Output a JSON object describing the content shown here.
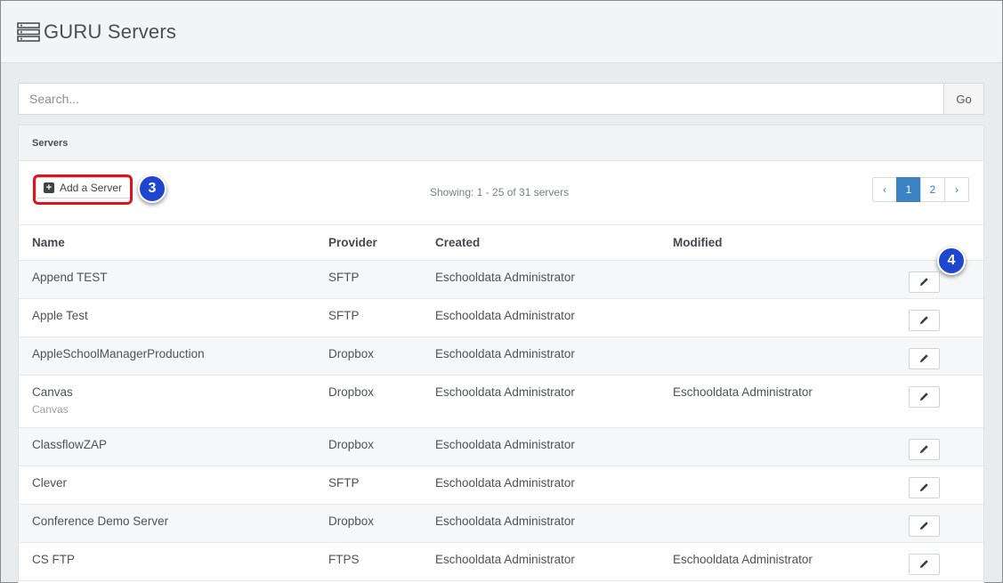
{
  "header": {
    "title": "GURU Servers",
    "icon": "server-icon"
  },
  "search": {
    "placeholder": "Search...",
    "value": "",
    "go_label": "Go"
  },
  "panel": {
    "heading": "Servers",
    "add_label": "Add a Server",
    "showing": "Showing: 1 - 25 of 31 servers"
  },
  "pagination": {
    "prev": "‹",
    "pages": [
      "1",
      "2"
    ],
    "active": "1",
    "next": "›"
  },
  "callouts": {
    "add": "3",
    "edit": "4"
  },
  "table": {
    "columns": {
      "name": "Name",
      "provider": "Provider",
      "created": "Created",
      "modified": "Modified"
    },
    "rows": [
      {
        "name": "Append TEST",
        "sub": "",
        "provider": "SFTP",
        "created": "Eschooldata Administrator",
        "modified": ""
      },
      {
        "name": "Apple Test",
        "sub": "",
        "provider": "SFTP",
        "created": "Eschooldata Administrator",
        "modified": ""
      },
      {
        "name": "AppleSchoolManagerProduction",
        "sub": "",
        "provider": "Dropbox",
        "created": "Eschooldata Administrator",
        "modified": ""
      },
      {
        "name": "Canvas",
        "sub": "Canvas",
        "provider": "Dropbox",
        "created": "Eschooldata Administrator",
        "modified": "Eschooldata Administrator"
      },
      {
        "name": "ClassflowZAP",
        "sub": "",
        "provider": "Dropbox",
        "created": "Eschooldata Administrator",
        "modified": ""
      },
      {
        "name": "Clever",
        "sub": "",
        "provider": "SFTP",
        "created": "Eschooldata Administrator",
        "modified": ""
      },
      {
        "name": "Conference Demo Server",
        "sub": "",
        "provider": "Dropbox",
        "created": "Eschooldata Administrator",
        "modified": ""
      },
      {
        "name": "CS FTP",
        "sub": "",
        "provider": "FTPS",
        "created": "Eschooldata Administrator",
        "modified": "Eschooldata Administrator"
      }
    ]
  },
  "colors": {
    "accent": "#3b82c4",
    "callout": "#1e46cf",
    "highlight": "#e0141c"
  }
}
